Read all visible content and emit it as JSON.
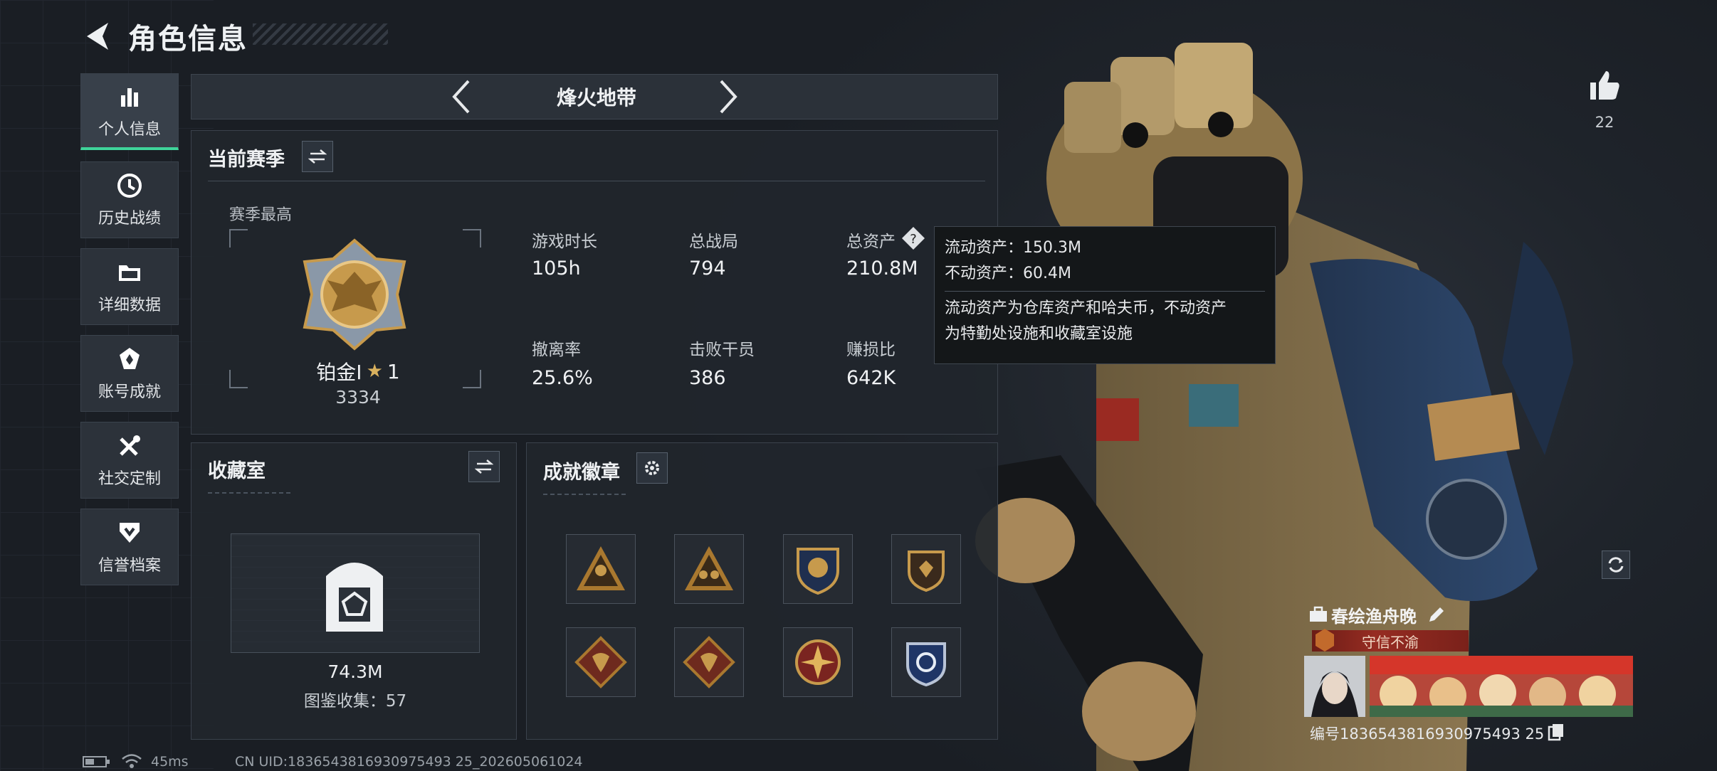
{
  "header": {
    "title": "角色信息"
  },
  "sidebar": {
    "items": [
      {
        "label": "个人信息",
        "icon": "bar-chart-icon",
        "active": true
      },
      {
        "label": "历史战绩",
        "icon": "clock-history-icon",
        "active": false
      },
      {
        "label": "详细数据",
        "icon": "folder-icon",
        "active": false
      },
      {
        "label": "账号成就",
        "icon": "achievement-icon",
        "active": false
      },
      {
        "label": "社交定制",
        "icon": "tools-icon",
        "active": false
      },
      {
        "label": "信誉档案",
        "icon": "credit-shield-icon",
        "active": false
      }
    ]
  },
  "mode_selector": {
    "current": "烽火地带"
  },
  "season": {
    "title": "当前赛季",
    "best_label": "赛季最高",
    "rank_name": "铂金I",
    "rank_stars": "1",
    "rank_score": "3334",
    "stats": [
      {
        "label": "游戏时长",
        "value": "105h"
      },
      {
        "label": "总战局",
        "value": "794"
      },
      {
        "label": "总资产",
        "value": "210.8M"
      },
      {
        "label": "撤离率",
        "value": "25.6%"
      },
      {
        "label": "击败干员",
        "value": "386"
      },
      {
        "label": "赚损比",
        "value": "642K"
      }
    ]
  },
  "tooltip": {
    "line1": "流动资产：150.3M",
    "line2": "不动资产：60.4M",
    "desc1": "流动资产为仓库资产和哈夫币，不动资产",
    "desc2": "为特勤处设施和收藏室设施"
  },
  "collection": {
    "title": "收藏室",
    "value": "74.3M",
    "count_text": "图鉴收集：57"
  },
  "achievements": {
    "title": "成就徽章",
    "badges": [
      "triangle-soldier-badge",
      "triangle-team-badge",
      "crest-shield-badge",
      "dark-shield-badge",
      "dragon-diamond-badge",
      "dragon-diamond-badge-2",
      "compass-crest-badge",
      "blue-shield-badge"
    ]
  },
  "profile": {
    "likes": "22",
    "name": "春绘渔舟晚",
    "title_tag": "守信不渝",
    "id_text": "编号1836543816930975493 25"
  },
  "status_bar": {
    "ping": "45ms",
    "uid_text": "CN UID:1836543816930975493 25_202605061024"
  },
  "colors": {
    "accent": "#3fd49a",
    "title_tag": "#962c22",
    "gold": "#c79a4c"
  }
}
